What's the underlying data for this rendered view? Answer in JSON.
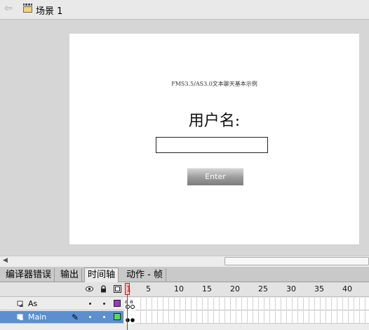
{
  "breadcrumb": {
    "scene_label": "场景 1"
  },
  "stage": {
    "caption": "FMS3.5/AS3.0文本聊天基本示例",
    "prompt": "用户名:",
    "input_value": "",
    "button_label": "Enter"
  },
  "panel_tabs": [
    {
      "label": "编译器错误"
    },
    {
      "label": "输出"
    },
    {
      "label": "时间轴"
    },
    {
      "label": "动作 - 帧"
    }
  ],
  "timeline": {
    "current_frame": "1",
    "ruler": [
      "5",
      "10",
      "15",
      "20",
      "25",
      "30",
      "35",
      "40"
    ],
    "layers": [
      {
        "name": "As",
        "color": "#a033cc"
      },
      {
        "name": "Main",
        "color": "#55dd55"
      }
    ]
  },
  "colors": {
    "stage_bg": "#ffffff",
    "selected_layer": "#5b8fd0",
    "playhead": "#cc2222"
  }
}
